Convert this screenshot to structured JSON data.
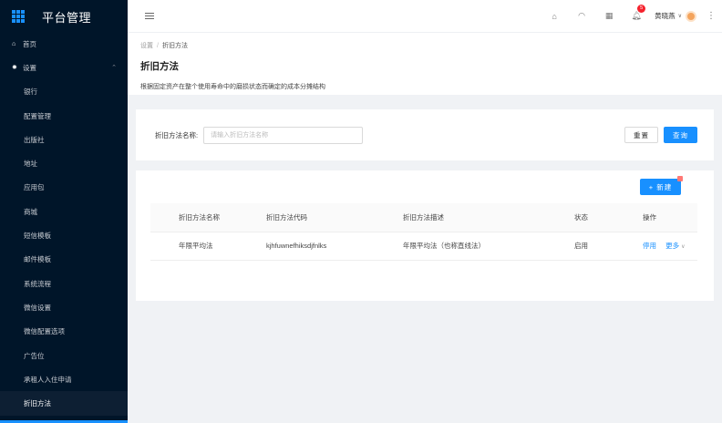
{
  "app": {
    "title": "平台管理"
  },
  "sidebar": {
    "home": "首页",
    "settings": "设置",
    "items": [
      "银行",
      "配置管理",
      "出版社",
      "地址",
      "应用包",
      "商城",
      "短信模板",
      "邮件模板",
      "系统流程",
      "微信设置",
      "微信配置选项",
      "广告位",
      "承租人入住申请",
      "折旧方法"
    ],
    "active_index": 13
  },
  "header": {
    "notification_count": "5",
    "user_name": "黄晓燕",
    "accent": "#1890ff"
  },
  "breadcrumb": {
    "parent": "设置",
    "current": "折旧方法"
  },
  "page": {
    "title": "折旧方法",
    "description": "根据固定资产在整个使用寿命中的磨损状态而确定的成本分摊结构"
  },
  "search": {
    "label": "折旧方法名称:",
    "placeholder": "请输入折旧方法名称",
    "reset": "重置",
    "query": "查询"
  },
  "table": {
    "add_button": "+ 新建",
    "columns": [
      "折旧方法名称",
      "折旧方法代码",
      "折旧方法描述",
      "状态",
      "操作"
    ],
    "rows": [
      {
        "name": "年限平均法",
        "code": "kjhfuwnefhiksdjfnlks",
        "desc": "年限平均法（也称直线法）",
        "status": "启用",
        "action_disable": "停用",
        "action_more": "更多"
      }
    ]
  }
}
